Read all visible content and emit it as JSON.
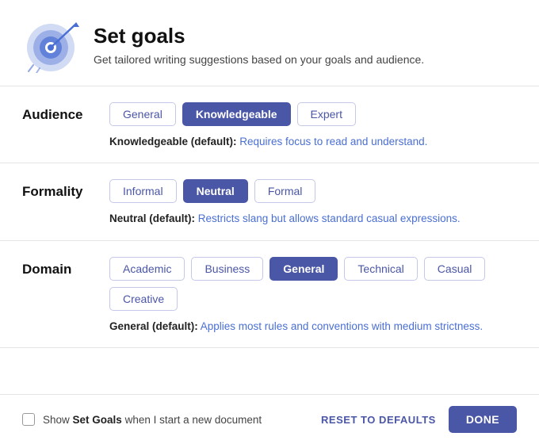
{
  "header": {
    "title": "Set goals",
    "description": "Get tailored writing suggestions based on your goals and audience."
  },
  "audience": {
    "label": "Audience",
    "options": [
      "General",
      "Knowledgeable",
      "Expert"
    ],
    "active": "Knowledgeable",
    "description_strong": "Knowledgeable (default):",
    "description_text": " Requires focus to read and understand."
  },
  "formality": {
    "label": "Formality",
    "options": [
      "Informal",
      "Neutral",
      "Formal"
    ],
    "active": "Neutral",
    "description_strong": "Neutral (default):",
    "description_text": " Restricts slang but allows standard casual expressions."
  },
  "domain": {
    "label": "Domain",
    "options": [
      "Academic",
      "Business",
      "General",
      "Technical",
      "Casual",
      "Creative"
    ],
    "active": "General",
    "description_strong": "General (default):",
    "description_text": " Applies most rules and conventions with medium strictness."
  },
  "footer": {
    "checkbox_label_pre": "Show ",
    "checkbox_label_bold": "Set Goals",
    "checkbox_label_post": " when I start a new document",
    "reset_label": "RESET TO DEFAULTS",
    "done_label": "DONE"
  }
}
